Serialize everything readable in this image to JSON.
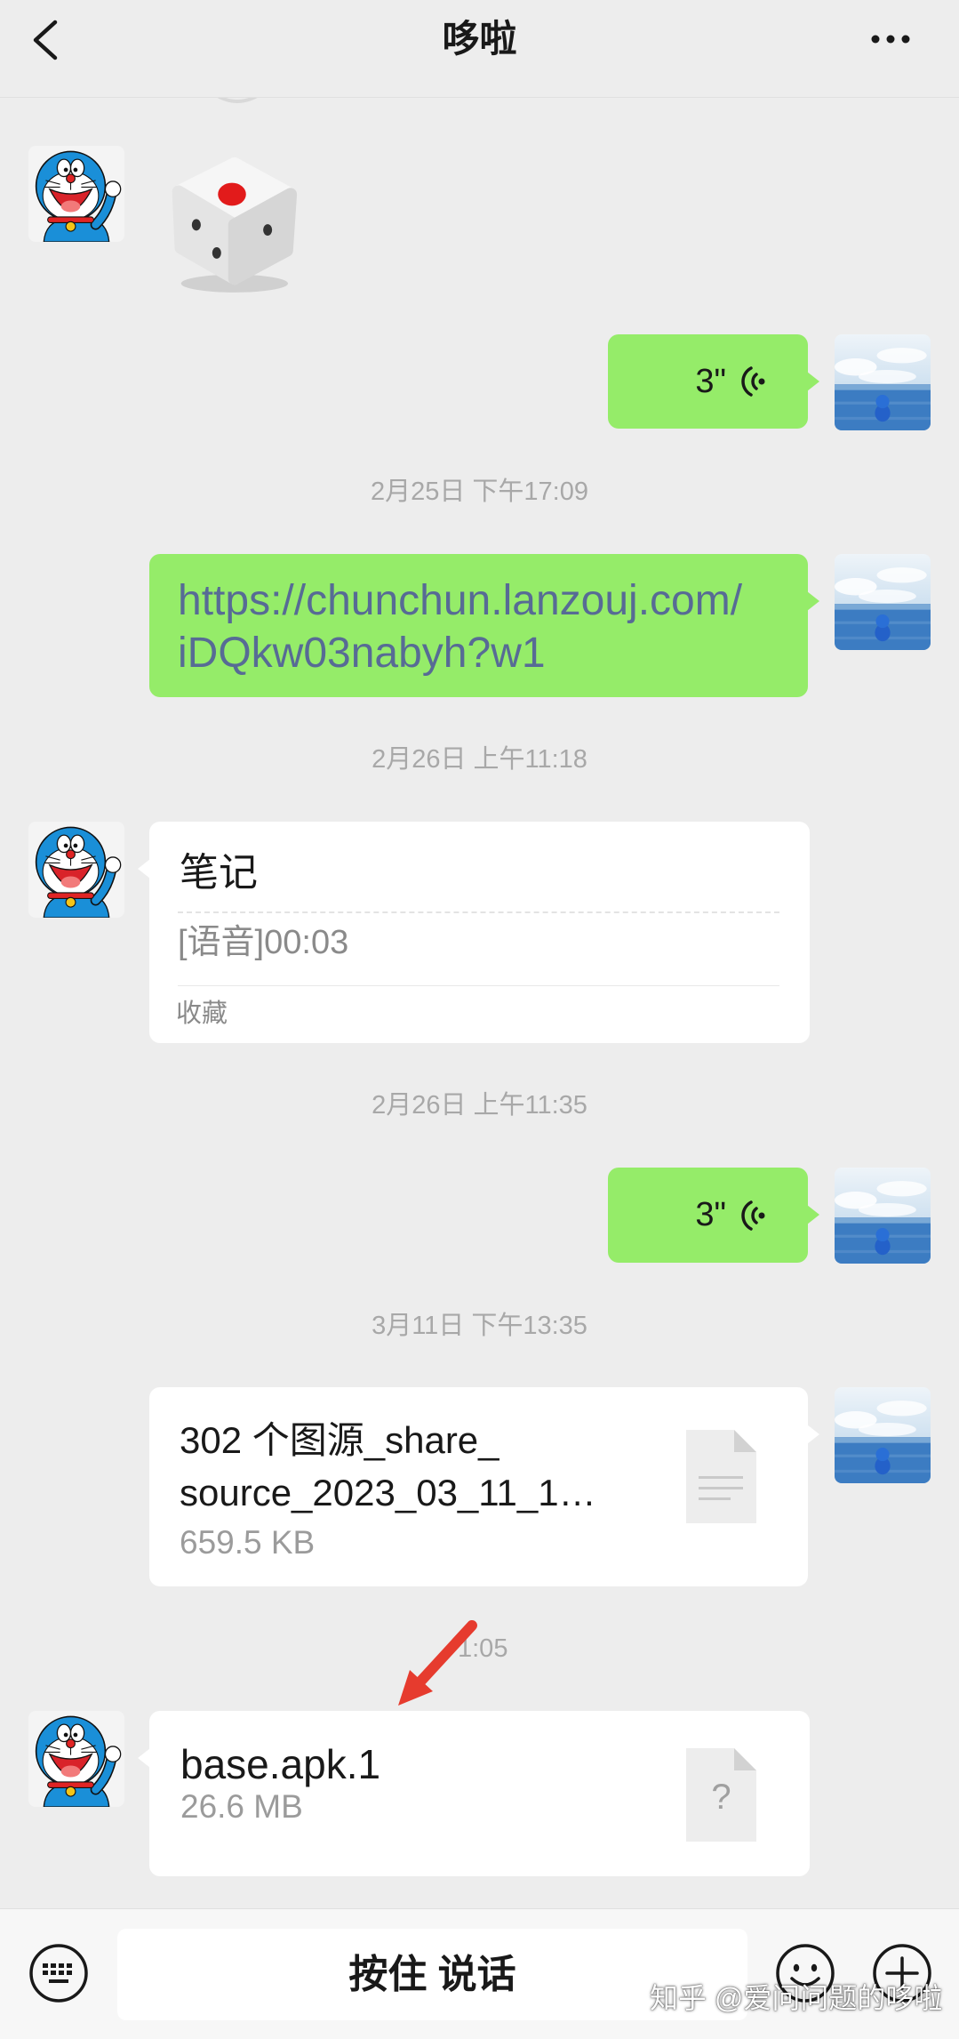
{
  "header": {
    "title": "哆啦",
    "back_icon": "chevron-left-icon",
    "more_icon": "more-dots-icon"
  },
  "messages": {
    "voice_1": {
      "duration": "3\"",
      "icon": "voice-wave-icon"
    },
    "time_1": "2月25日 下午17:09",
    "link": {
      "lines": [
        "https://chunchun.lanzouj.com/",
        "iDQkw03nabyh?w1"
      ]
    },
    "time_2": "2月26日 上午11:18",
    "note": {
      "title": "笔记",
      "content": "[语音]00:03",
      "source": "收藏"
    },
    "time_3": "2月26日 上午11:35",
    "voice_2": {
      "duration": "3\"",
      "icon": "voice-wave-icon"
    },
    "time_4": "3月11日 下午13:35",
    "file_1": {
      "name_lines": [
        "302 个图源_share_",
        "source_2023_03_11_1…"
      ],
      "size": "659.5 KB",
      "icon": "document-file-icon"
    },
    "time_5_partial": "1:05",
    "file_2": {
      "name": "base.apk.1",
      "size": "26.6 MB",
      "icon": "unknown-file-icon",
      "icon_glyph": "?"
    }
  },
  "input_bar": {
    "hold_to_talk_label": "按住 说话",
    "keyboard_icon": "keyboard-icon",
    "emoji_icon": "emoji-icon",
    "plus_icon": "plus-icon"
  },
  "watermark": "知乎 @爱问问题的哆啦",
  "annotation": {
    "arrow_icon": "red-arrow-icon",
    "arrow_color": "#E63B2E"
  },
  "colors": {
    "background": "#EDEDED",
    "sent_bubble": "#95EC69",
    "received_bubble": "#FFFFFF",
    "link_text": "#576B95",
    "timestamp_text": "#A8A8A8"
  }
}
